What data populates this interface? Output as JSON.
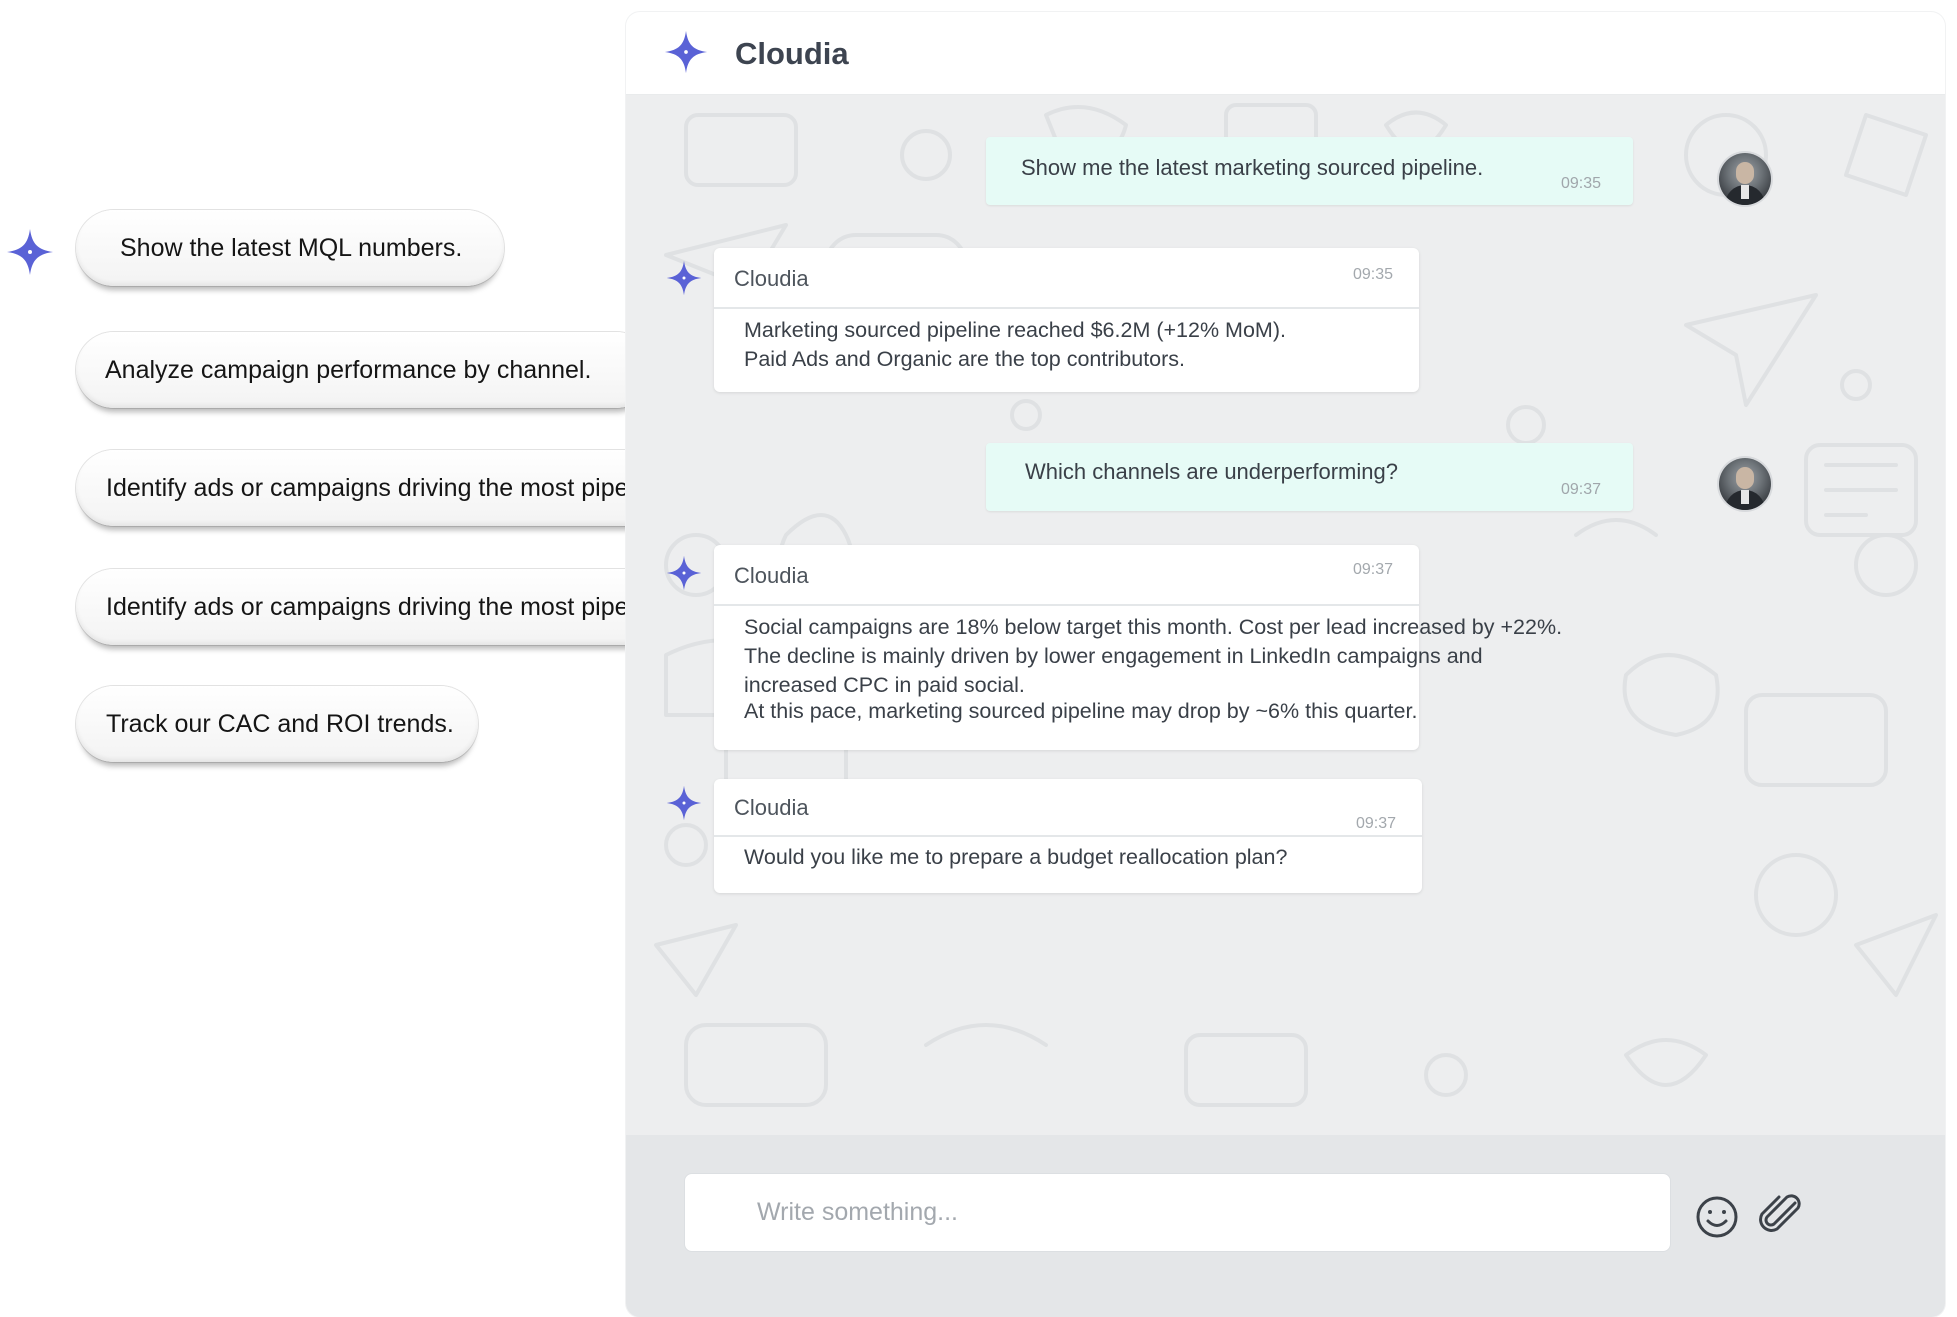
{
  "assistant_name": "Cloudia",
  "colors": {
    "accent": "#5a62d6",
    "user_bubble": "#e6fbf6",
    "chat_background": "#edeeef",
    "composer_background": "#e4e6e8"
  },
  "icons": {
    "assistant": "sparkle-star-icon",
    "emoji": "smiley-icon",
    "attach": "paperclip-icon",
    "user": "avatar"
  },
  "suggestions": [
    "Show the latest MQL numbers.",
    "Analyze campaign performance by channel.",
    "Identify ads or campaigns driving the most pipeline.",
    "Identify ads or campaigns driving the most pipeline.",
    "Track our CAC and ROI trends."
  ],
  "chat": {
    "title": "Cloudia",
    "messages": [
      {
        "role": "user",
        "text": "Show me the latest marketing sourced pipeline.",
        "time": "09:35"
      },
      {
        "role": "assistant",
        "name": "Cloudia",
        "time": "09:35",
        "lines": [
          "Marketing sourced pipeline reached $6.2M (+12% MoM).",
          "Paid Ads and Organic are the top contributors."
        ]
      },
      {
        "role": "user",
        "text": "Which channels are underperforming?",
        "time": "09:37"
      },
      {
        "role": "assistant",
        "name": "Cloudia",
        "time": "09:37",
        "lines": [
          "Social campaigns are 18% below target this month. Cost per lead increased by +22%.",
          "The decline is mainly driven by lower engagement in LinkedIn campaigns and",
          "increased CPC in paid social.",
          "At this pace, marketing sourced pipeline may drop by ~6% this quarter."
        ]
      },
      {
        "role": "assistant",
        "name": "Cloudia",
        "time": "09:37",
        "lines": [
          "Would you like me to prepare a budget reallocation plan?"
        ]
      }
    ]
  },
  "composer": {
    "placeholder": "Write something..."
  }
}
